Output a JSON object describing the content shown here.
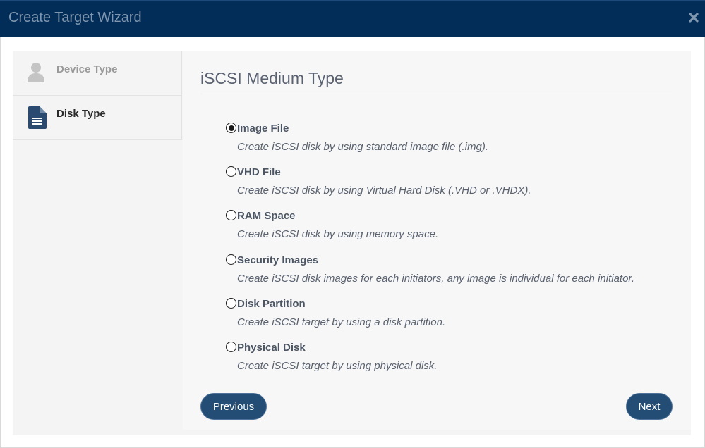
{
  "window": {
    "title": "Create Target Wizard"
  },
  "icons": {
    "close": "close-icon",
    "user": "user-icon",
    "document": "document-icon"
  },
  "colors": {
    "titlebar": "#022d59",
    "button": "#234d74",
    "step_active": "#2b4a70",
    "step_inactive": "#c4c4c4"
  },
  "steps": [
    {
      "label": "Device Type",
      "active": false
    },
    {
      "label": "Disk Type",
      "active": true
    }
  ],
  "content": {
    "heading": "iSCSI Medium Type",
    "options": [
      {
        "label": "Image File",
        "description": "Create iSCSI disk by using standard image file (.img).",
        "selected": true
      },
      {
        "label": "VHD File",
        "description": "Create iSCSI disk by using Virtual Hard Disk (.VHD or .VHDX).",
        "selected": false
      },
      {
        "label": "RAM Space",
        "description": "Create iSCSI disk by using memory space.",
        "selected": false
      },
      {
        "label": "Security Images",
        "description": "Create iSCSI disk images for each initiators, any image is individual for each initiator.",
        "selected": false
      },
      {
        "label": "Disk Partition",
        "description": "Create iSCSI target by using a disk partition.",
        "selected": false
      },
      {
        "label": "Physical Disk",
        "description": "Create iSCSI target by using physical disk.",
        "selected": false
      }
    ]
  },
  "buttons": {
    "previous": "Previous",
    "next": "Next"
  }
}
